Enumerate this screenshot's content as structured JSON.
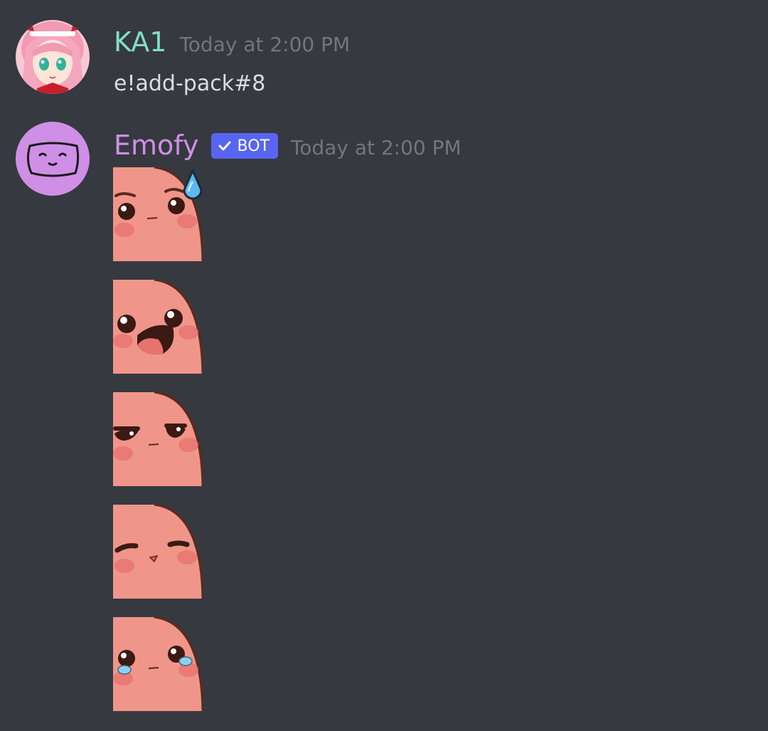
{
  "messages": [
    {
      "author": "KA1",
      "author_color": "#7fe0c4",
      "timestamp": "Today at 2:00 PM",
      "content": "e!add-pack#8",
      "avatar_icon": "anime-girl-avatar"
    },
    {
      "author": "Emofy",
      "author_color": "#cf8fe6",
      "timestamp": "Today at 2:00 PM",
      "bot_tag": "BOT",
      "bot_verified_icon": "checkmark-icon",
      "avatar_icon": "smile-face-avatar",
      "emojis": [
        "sweat-emoji",
        "shocked-emoji",
        "annoyed-emoji",
        "smug-emoji",
        "crying-emoji"
      ]
    }
  ],
  "colors": {
    "background": "#36393f",
    "blob": "#f0958a",
    "blob_outline": "#5a2a1e",
    "blush": "#e8736e",
    "bot_tag": "#5865f2"
  }
}
